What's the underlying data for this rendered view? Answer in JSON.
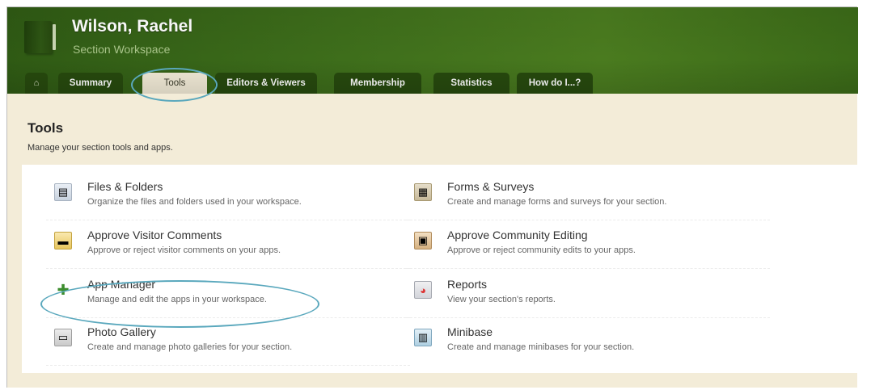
{
  "header": {
    "title": "Wilson, Rachel",
    "subtitle": "Section Workspace"
  },
  "tabs": [
    {
      "label": "",
      "icon": "home-icon"
    },
    {
      "label": "Summary"
    },
    {
      "label": "Tools",
      "active": true
    },
    {
      "label": "Editors & Viewers"
    },
    {
      "label": "Membership"
    },
    {
      "label": "Statistics"
    },
    {
      "label": "How do I...?"
    }
  ],
  "tools_section": {
    "title": "Tools",
    "subtitle": "Manage your section tools and apps."
  },
  "tools": [
    {
      "name": "Files & Folders",
      "desc": "Organize the files and folders used in your workspace.",
      "icon": "files-icon"
    },
    {
      "name": "Forms & Surveys",
      "desc": "Create and manage forms and surveys for your section.",
      "icon": "forms-icon"
    },
    {
      "name": "Approve Visitor Comments",
      "desc": "Approve or reject visitor comments on your apps.",
      "icon": "comments-icon"
    },
    {
      "name": "Approve Community Editing",
      "desc": "Approve or reject community edits to your apps.",
      "icon": "community-editing-icon"
    },
    {
      "name": "App Manager",
      "desc": "Manage and edit the apps in your workspace.",
      "icon": "puzzle-icon"
    },
    {
      "name": "Reports",
      "desc": "View your section's reports.",
      "icon": "reports-icon"
    },
    {
      "name": "Photo Gallery",
      "desc": "Create and manage photo galleries for your section.",
      "icon": "photo-gallery-icon"
    },
    {
      "name": "Minibase",
      "desc": "Create and manage minibases for your section.",
      "icon": "minibase-icon"
    }
  ],
  "colors": {
    "header_green": "#3e6e1b",
    "tab_dark": "#274a0e",
    "content_bg": "#f3ecd8",
    "highlight_circle": "#5aa8bd"
  }
}
